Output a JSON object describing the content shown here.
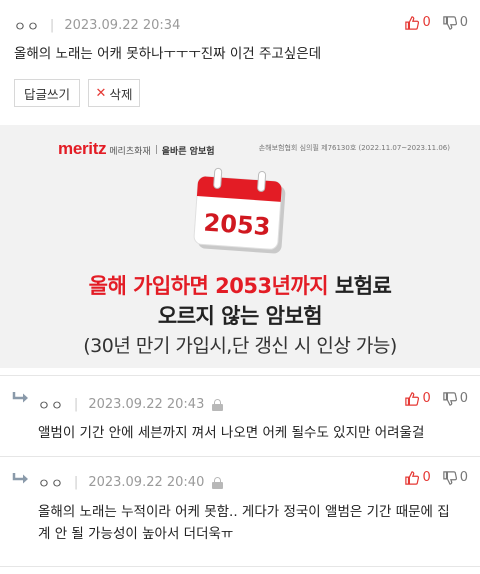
{
  "comments": [
    {
      "author": "ㅇㅇ",
      "date": "2023.09.22 20:34",
      "text": "올해의 노래는 어캐 못하나ㅜㅜㅜ진짜 이건 주고싶은데",
      "up": "0",
      "down": "0",
      "reply_label": "답글쓰기",
      "delete_label": "삭제"
    },
    {
      "author": "ㅇㅇ",
      "date": "2023.09.22 20:43",
      "text": "앨범이 기간 안에 세븐까지 껴서 나오면 어케 될수도 있지만 어려울걸",
      "up": "0",
      "down": "0"
    },
    {
      "author": "ㅇㅇ",
      "date": "2023.09.22 20:40",
      "text_line1": "올해의 노래는 누적이라 어케 못함.. 게다가 정국이 앨범은 기간 때문에 집",
      "text_line2": "계 안 될 가능성이 높아서 더더욱ㅠ",
      "up": "0",
      "down": "0"
    }
  ],
  "ad": {
    "brand": "meritz",
    "brand_kr": "메리츠화재",
    "product": "올바른 암보험",
    "notice": "손해보험협회 심의필 제76130호 (2022.11.07~2023.11.06)",
    "calendar_year": "2053",
    "line1_red": "올해 가입하면 2053년까지",
    "line1_dark": " 보험료",
    "line2": "오르지 않는 암보험",
    "line3": "(30년 만기 가입시,단 갱신 시 인상 가능)",
    "accent_color": "#e31c25"
  },
  "icons": {
    "thumbs_up": "thumbs-up-icon",
    "thumbs_down": "thumbs-down-icon",
    "reply_arrow": "reply-arrow-icon",
    "lock": "lock-icon",
    "close": "close-icon"
  }
}
